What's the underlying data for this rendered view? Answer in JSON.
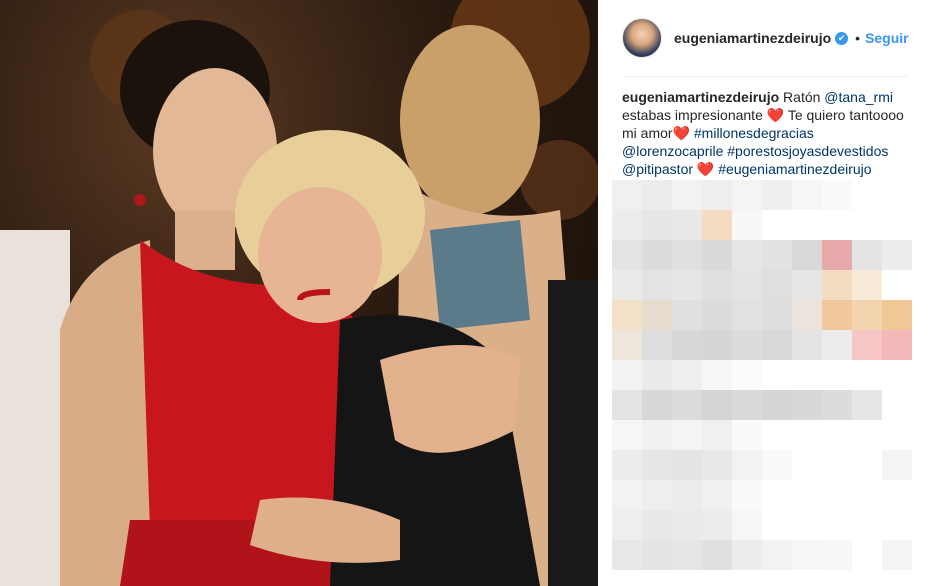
{
  "post": {
    "username": "eugeniamartinezdeirujo",
    "verified_icon": "✔",
    "separator": "•",
    "follow_label": "Seguir"
  },
  "caption": {
    "user": "eugeniamartinezdeirujo",
    "t1": " Ratón ",
    "m1": "@tana_rmi",
    "t2": " estabas impresionante ",
    "h1": "❤️",
    "t3": " Te quiero tantoooo mi amor",
    "h2": "❤️",
    "t4": " ",
    "tag1": "#millonesdegracias",
    "t5": " ",
    "m2": "@lorenzocaprile",
    "t6": " ",
    "tag2": "#porestosjoyasdevestidos",
    "t7": " ",
    "m3": "@pitipastor",
    "t8": " ",
    "h3": "❤️",
    "t9": " ",
    "tag3": "#eugeniamartinezdeirujo"
  },
  "colors": {
    "accent": "#3897f0",
    "link": "#003569",
    "heart": "#ed1c24"
  }
}
